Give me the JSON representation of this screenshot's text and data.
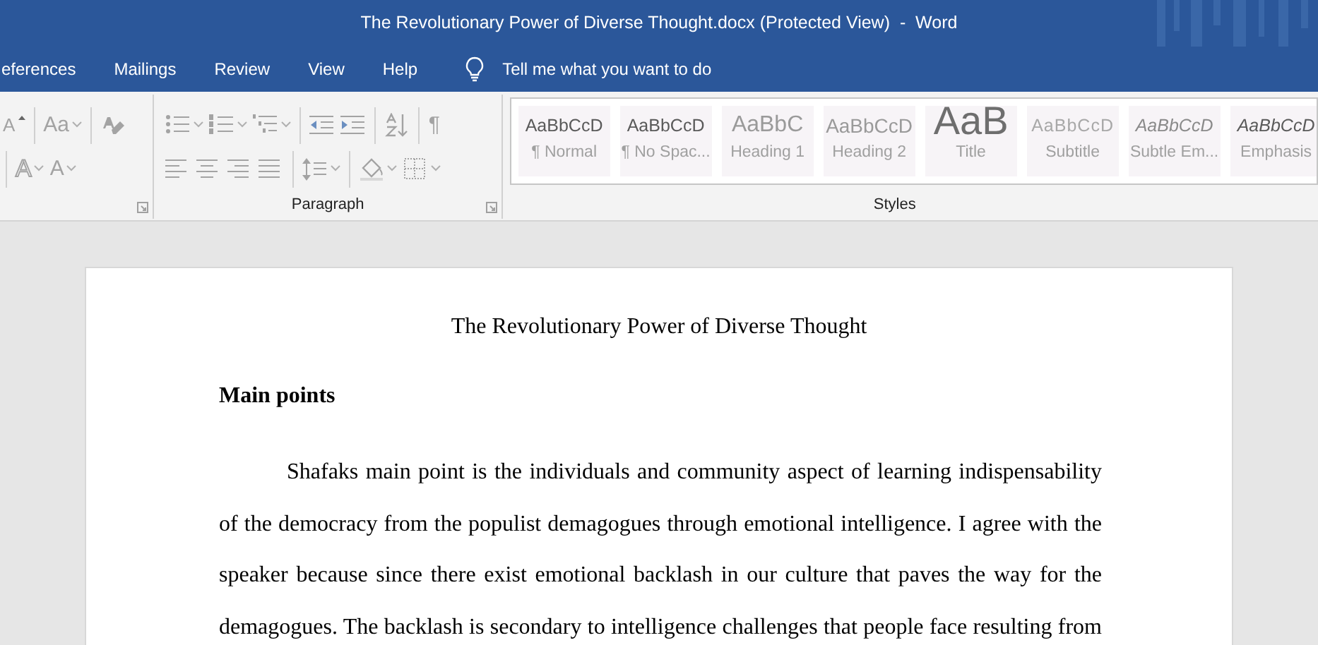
{
  "window": {
    "title": "The Revolutionary Power of Diverse Thought.docx (Protected View)  -  Word"
  },
  "tabs": [
    {
      "label": "eferences",
      "selected": false
    },
    {
      "label": "Mailings",
      "selected": false
    },
    {
      "label": "Review",
      "selected": false
    },
    {
      "label": "View",
      "selected": false
    },
    {
      "label": "Help",
      "selected": false
    }
  ],
  "tell_me": {
    "placeholder": "Tell me what you want to do"
  },
  "ribbon": {
    "groups": [
      {
        "launcher": true,
        "rows": [
          [
            {
              "kind": "grow-font",
              "glyph": "A",
              "disabled": true
            },
            {
              "kind": "sep"
            },
            {
              "kind": "text",
              "glyph": "Aa",
              "disabled": true,
              "dropdown": true
            },
            {
              "kind": "sep"
            },
            {
              "kind": "clear-format",
              "disabled": true
            }
          ],
          [
            {
              "kind": "sep"
            },
            {
              "kind": "text-effects",
              "glyph": "A",
              "disabled": true,
              "dropdown": true
            },
            {
              "kind": "text",
              "glyph": "A",
              "disabled": true,
              "dropdown": true
            }
          ]
        ]
      },
      {
        "label": "Paragraph",
        "launcher": true,
        "rows": [
          [
            {
              "kind": "bullets",
              "disabled": true,
              "dropdown": true
            },
            {
              "kind": "numbering",
              "disabled": true,
              "dropdown": true
            },
            {
              "kind": "multilevel",
              "disabled": true,
              "dropdown": true
            },
            {
              "kind": "sep"
            },
            {
              "kind": "outdent",
              "disabled": true
            },
            {
              "kind": "indent",
              "disabled": true
            },
            {
              "kind": "sep"
            },
            {
              "kind": "sort",
              "disabled": true
            },
            {
              "kind": "sep"
            },
            {
              "kind": "text",
              "glyph": "¶",
              "disabled": true
            }
          ],
          [
            {
              "kind": "align-left",
              "disabled": true
            },
            {
              "kind": "align-center",
              "disabled": true
            },
            {
              "kind": "align-right",
              "disabled": true
            },
            {
              "kind": "justify",
              "disabled": true
            },
            {
              "kind": "sep"
            },
            {
              "kind": "line-spacing",
              "disabled": true,
              "dropdown": true
            },
            {
              "kind": "sep"
            },
            {
              "kind": "shading",
              "disabled": true,
              "dropdown": true
            },
            {
              "kind": "borders",
              "disabled": true,
              "dropdown": true
            }
          ]
        ]
      }
    ]
  },
  "styles": {
    "label": "Styles",
    "items": [
      {
        "kind": "normal",
        "preview": "AaBbCcD",
        "name": "¶ Normal"
      },
      {
        "kind": "normal",
        "preview": "AaBbCcD",
        "name": "¶ No Spac..."
      },
      {
        "kind": "heading1",
        "preview": "AaBbC",
        "name": "Heading 1"
      },
      {
        "kind": "heading2",
        "preview": "AaBbCcD",
        "name": "Heading 2"
      },
      {
        "kind": "title",
        "preview": "AaB",
        "name": "Title"
      },
      {
        "kind": "subtitle",
        "preview": "AaBbCcD",
        "name": "Subtitle"
      },
      {
        "kind": "italic",
        "preview": "AaBbCcD",
        "name": "Subtle Em..."
      },
      {
        "kind": "italic-dark",
        "preview": "AaBbCcD",
        "name": "Emphasis"
      }
    ]
  },
  "document": {
    "title": "The Revolutionary Power of Diverse Thought",
    "heading": "Main points",
    "paragraph": "Shafaks main point is the individuals and community aspect of learning indispensability of the democracy from the populist demagogues through emotional intelligence. I agree with the speaker because since there exist emotional backlash in our culture that paves the way for the demagogues. The backlash is secondary to intelligence challenges that people face resulting from"
  }
}
